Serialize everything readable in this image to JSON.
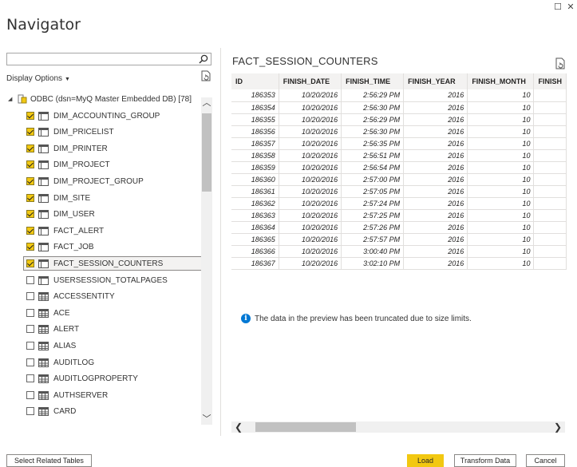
{
  "window": {
    "title": "Navigator",
    "restore_glyph": "☐",
    "close_glyph": "✕"
  },
  "left": {
    "search": {
      "value": "",
      "placeholder": ""
    },
    "display_options": "Display Options",
    "tree": {
      "root": {
        "label": "ODBC (dsn=MyQ Master Embedded DB) [78]",
        "expanded": true
      },
      "items": [
        {
          "label": "DIM_ACCOUNTING_GROUP",
          "checked": true,
          "icon": "table-view-icon"
        },
        {
          "label": "DIM_PRICELIST",
          "checked": true,
          "icon": "table-view-icon"
        },
        {
          "label": "DIM_PRINTER",
          "checked": true,
          "icon": "table-view-icon"
        },
        {
          "label": "DIM_PROJECT",
          "checked": true,
          "icon": "table-view-icon"
        },
        {
          "label": "DIM_PROJECT_GROUP",
          "checked": true,
          "icon": "table-view-icon"
        },
        {
          "label": "DIM_SITE",
          "checked": true,
          "icon": "table-view-icon"
        },
        {
          "label": "DIM_USER",
          "checked": true,
          "icon": "table-view-icon"
        },
        {
          "label": "FACT_ALERT",
          "checked": true,
          "icon": "table-view-icon"
        },
        {
          "label": "FACT_JOB",
          "checked": true,
          "icon": "table-view-icon"
        },
        {
          "label": "FACT_SESSION_COUNTERS",
          "checked": true,
          "icon": "table-view-icon",
          "selected": true
        },
        {
          "label": "USERSESSION_TOTALPAGES",
          "checked": false,
          "icon": "table-view-icon"
        },
        {
          "label": "ACCESSENTITY",
          "checked": false,
          "icon": "table-grid-icon"
        },
        {
          "label": "ACE",
          "checked": false,
          "icon": "table-grid-icon"
        },
        {
          "label": "ALERT",
          "checked": false,
          "icon": "table-grid-icon"
        },
        {
          "label": "ALIAS",
          "checked": false,
          "icon": "table-grid-icon"
        },
        {
          "label": "AUDITLOG",
          "checked": false,
          "icon": "table-grid-icon"
        },
        {
          "label": "AUDITLOGPROPERTY",
          "checked": false,
          "icon": "table-grid-icon"
        },
        {
          "label": "AUTHSERVER",
          "checked": false,
          "icon": "table-grid-icon"
        },
        {
          "label": "CARD",
          "checked": false,
          "icon": "table-grid-icon"
        }
      ]
    }
  },
  "preview": {
    "title": "FACT_SESSION_COUNTERS",
    "columns": [
      "ID",
      "FINISH_DATE",
      "FINISH_TIME",
      "FINISH_YEAR",
      "FINISH_MONTH",
      "FINISH"
    ],
    "rows": [
      [
        "186353",
        "10/20/2016",
        "2:56:29 PM",
        "2016",
        "10",
        ""
      ],
      [
        "186354",
        "10/20/2016",
        "2:56:30 PM",
        "2016",
        "10",
        ""
      ],
      [
        "186355",
        "10/20/2016",
        "2:56:29 PM",
        "2016",
        "10",
        ""
      ],
      [
        "186356",
        "10/20/2016",
        "2:56:30 PM",
        "2016",
        "10",
        ""
      ],
      [
        "186357",
        "10/20/2016",
        "2:56:35 PM",
        "2016",
        "10",
        ""
      ],
      [
        "186358",
        "10/20/2016",
        "2:56:51 PM",
        "2016",
        "10",
        ""
      ],
      [
        "186359",
        "10/20/2016",
        "2:56:54 PM",
        "2016",
        "10",
        ""
      ],
      [
        "186360",
        "10/20/2016",
        "2:57:00 PM",
        "2016",
        "10",
        ""
      ],
      [
        "186361",
        "10/20/2016",
        "2:57:05 PM",
        "2016",
        "10",
        ""
      ],
      [
        "186362",
        "10/20/2016",
        "2:57:24 PM",
        "2016",
        "10",
        ""
      ],
      [
        "186363",
        "10/20/2016",
        "2:57:25 PM",
        "2016",
        "10",
        ""
      ],
      [
        "186364",
        "10/20/2016",
        "2:57:26 PM",
        "2016",
        "10",
        ""
      ],
      [
        "186365",
        "10/20/2016",
        "2:57:57 PM",
        "2016",
        "10",
        ""
      ],
      [
        "186366",
        "10/20/2016",
        "3:00:40 PM",
        "2016",
        "10",
        ""
      ],
      [
        "186367",
        "10/20/2016",
        "3:02:10 PM",
        "2016",
        "10",
        ""
      ]
    ],
    "notice": "The data in the preview has been truncated due to size limits."
  },
  "footer": {
    "select_related": "Select Related Tables",
    "load": "Load",
    "transform": "Transform Data",
    "cancel": "Cancel"
  },
  "colors": {
    "accent": "#f2c811",
    "info": "#0078d4"
  }
}
